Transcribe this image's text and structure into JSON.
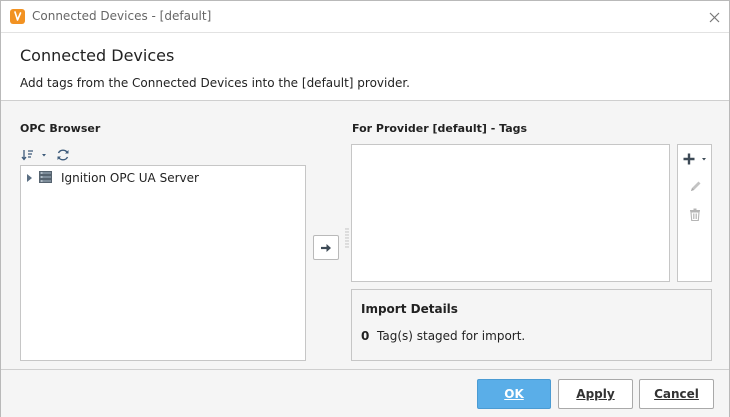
{
  "window": {
    "title": "Connected Devices - [default]",
    "app_icon": "ignition-logo-icon",
    "close_icon": "close-icon"
  },
  "header": {
    "title": "Connected Devices",
    "subtitle": "Add tags from the Connected Devices into the [default] provider."
  },
  "opc_browser": {
    "label": "OPC Browser",
    "toolbar": {
      "sort_icon": "sort-icon",
      "refresh_icon": "refresh-icon"
    },
    "tree": [
      {
        "label": "Ignition OPC UA Server",
        "icon": "server-icon",
        "expanded": false
      }
    ]
  },
  "move_button_icon": "arrow-right-icon",
  "provider_tags": {
    "label": "For Provider [default] - Tags",
    "toolbar": {
      "add_icon": "plus-icon",
      "edit_icon": "pencil-icon",
      "delete_icon": "trash-icon"
    }
  },
  "import_details": {
    "title": "Import Details",
    "count": "0",
    "text": "Tag(s) staged for import."
  },
  "buttons": {
    "ok": "OK",
    "apply": "Apply",
    "cancel": "Cancel"
  },
  "colors": {
    "accent": "#5aaee8",
    "app_icon": "#f29222",
    "background": "#f5f5f5"
  }
}
